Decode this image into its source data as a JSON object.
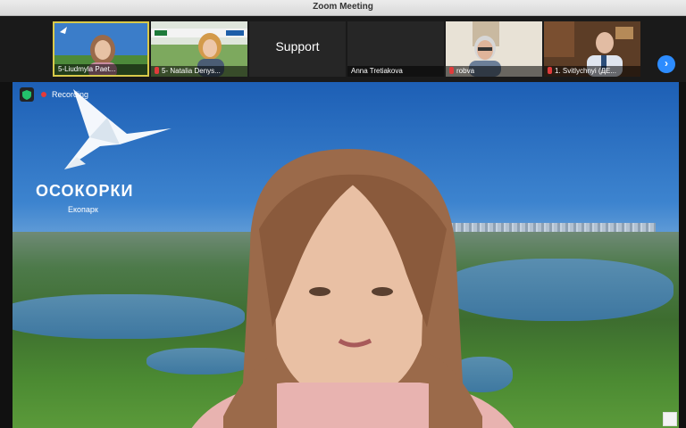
{
  "window": {
    "title": "Zoom Meeting"
  },
  "participants": [
    {
      "name": "5-Liudmyla Paet...",
      "muted": false,
      "active": true
    },
    {
      "name": "5- Natalia Denys...",
      "muted": true,
      "active": false
    },
    {
      "name": "",
      "big_label": "Support",
      "muted": false,
      "active": false
    },
    {
      "name": "Anna Tretiakova",
      "muted": false,
      "active": false
    },
    {
      "name": "robva",
      "muted": true,
      "active": false
    },
    {
      "name": "1. Svitlychnyi (ДЕ...",
      "muted": true,
      "active": false
    }
  ],
  "recording": {
    "label": "Recording"
  },
  "background": {
    "logo_title": "ОСОКОРКИ",
    "logo_subtitle": "Екопарк"
  },
  "colors": {
    "accent": "#2d8cff",
    "active_border": "#d9c94a",
    "record": "#e53a3a"
  },
  "icons": {
    "next": "chevron-right-icon",
    "secure": "shield-icon",
    "mic_off": "mic-off-icon"
  }
}
